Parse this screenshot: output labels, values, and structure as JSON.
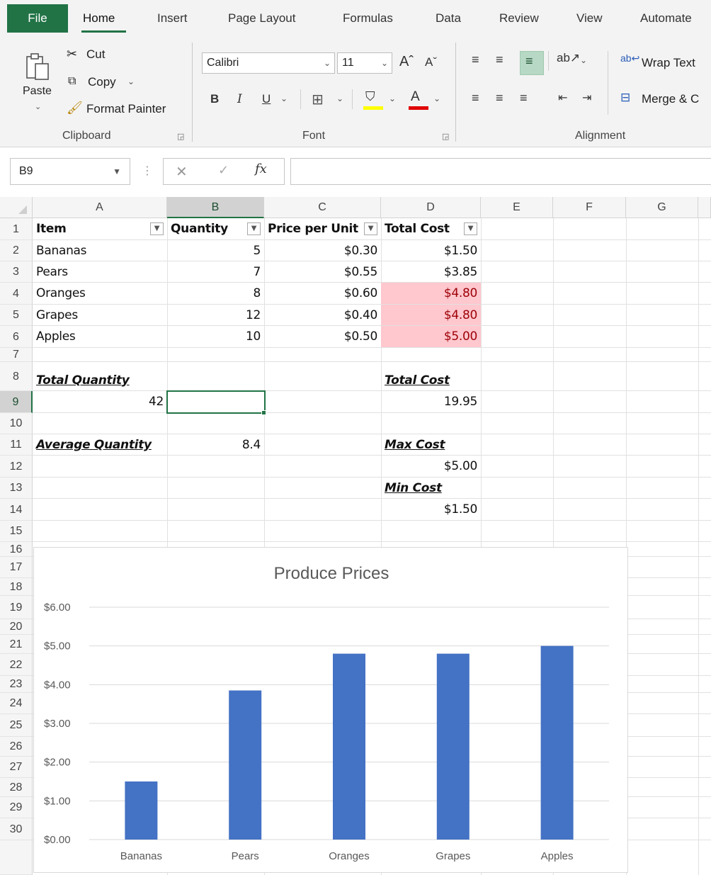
{
  "ribbon_tabs": {
    "file": "File",
    "home": "Home",
    "insert": "Insert",
    "page_layout": "Page Layout",
    "formulas": "Formulas",
    "data": "Data",
    "review": "Review",
    "view": "View",
    "automate": "Automate"
  },
  "clipboard": {
    "paste": "Paste",
    "cut": "Cut",
    "copy": "Copy",
    "format_painter": "Format Painter",
    "group_label": "Clipboard"
  },
  "font": {
    "font_name": "Calibri",
    "font_size": "11",
    "bold": "B",
    "italic": "I",
    "underline": "U",
    "group_label": "Font"
  },
  "alignment": {
    "wrap_text": "Wrap Text",
    "merge": "Merge & C",
    "group_label": "Alignment"
  },
  "formula_bar": {
    "name_box": "B9",
    "fx": "fx",
    "formula": ""
  },
  "columns": [
    "A",
    "B",
    "C",
    "D",
    "E",
    "F",
    "G"
  ],
  "selected_column": "B",
  "selected_row": "9",
  "rows": [
    "1",
    "2",
    "3",
    "4",
    "5",
    "6",
    "7",
    "8",
    "9",
    "10",
    "11",
    "12",
    "13",
    "14",
    "15",
    "16",
    "17",
    "18",
    "19",
    "20",
    "21",
    "22",
    "23",
    "24",
    "25",
    "26",
    "27",
    "28",
    "29",
    "30"
  ],
  "table": {
    "headers": [
      "Item",
      "Quantity",
      "Price per Unit",
      "Total Cost"
    ],
    "data": [
      [
        "Bananas",
        "5",
        "$0.30",
        "$1.50"
      ],
      [
        "Pears",
        "7",
        "$0.55",
        "$3.85"
      ],
      [
        "Oranges",
        "8",
        "$0.60",
        "$4.80"
      ],
      [
        "Grapes",
        "12",
        "$0.40",
        "$4.80"
      ],
      [
        "Apples",
        "10",
        "$0.50",
        "$5.00"
      ]
    ]
  },
  "summary": {
    "total_quantity_label": "Total Quantity",
    "total_quantity_value": "42",
    "average_quantity_label": "Average Quantity",
    "average_quantity_value": "8.4",
    "total_cost_label": "Total Cost",
    "total_cost_value": "19.95",
    "max_cost_label": "Max Cost",
    "max_cost_value": "$5.00",
    "min_cost_label": "Min Cost",
    "min_cost_value": "$1.50"
  },
  "colors": {
    "excel_green": "#217346",
    "highlight_fill": "#ffc7ce",
    "highlight_text": "#9c0006",
    "bar": "#4472c4"
  },
  "chart_data": {
    "type": "bar",
    "title": "Produce Prices",
    "categories": [
      "Bananas",
      "Pears",
      "Oranges",
      "Grapes",
      "Apples"
    ],
    "values": [
      1.5,
      3.85,
      4.8,
      4.8,
      5.0
    ],
    "ylim": [
      0,
      6
    ],
    "yticks": [
      "$0.00",
      "$1.00",
      "$2.00",
      "$3.00",
      "$4.00",
      "$5.00",
      "$6.00"
    ],
    "grid": true,
    "xlabel": "",
    "ylabel": ""
  }
}
